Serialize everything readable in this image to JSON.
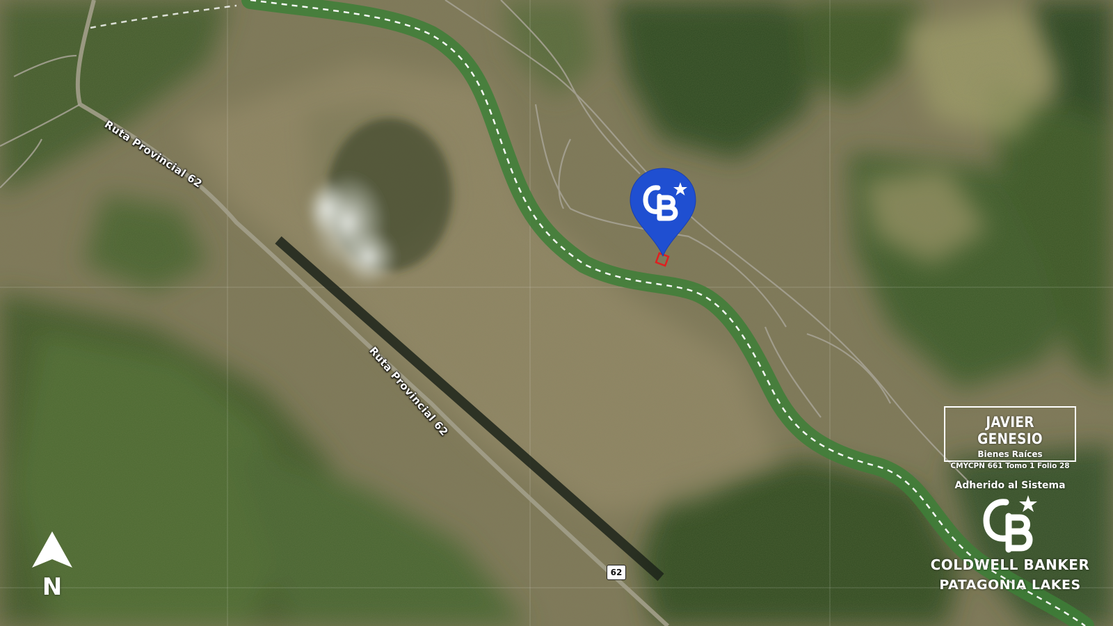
{
  "map": {
    "type": "satellite",
    "colors": {
      "terrain": "#8a7f5f",
      "forest": "#3f5a2a",
      "river": "#3f8a3a",
      "road": "#9a9688",
      "pin": "#1f4fd1",
      "marker": "#e02020"
    }
  },
  "roads": {
    "label_upper": "Ruta Provincial 62",
    "label_lower": "Ruta Provincial 62",
    "shield": "62"
  },
  "location_pin": {
    "icon": "coldwell-banker-pin-icon",
    "monogram": "CB"
  },
  "compass": {
    "icon": "north-arrow-icon",
    "letter": "N"
  },
  "agent": {
    "name": "JAVIER GENESIO",
    "subtitle": "Bienes Raíces",
    "license": "CMYCPN 661 Tomo 1 Folio 28"
  },
  "brand": {
    "adherido": "Adherido al Sistema",
    "logo": "coldwell-banker-logo",
    "line1": "COLDWELL BANKER",
    "line2": "PATAGONIA LAKES"
  }
}
